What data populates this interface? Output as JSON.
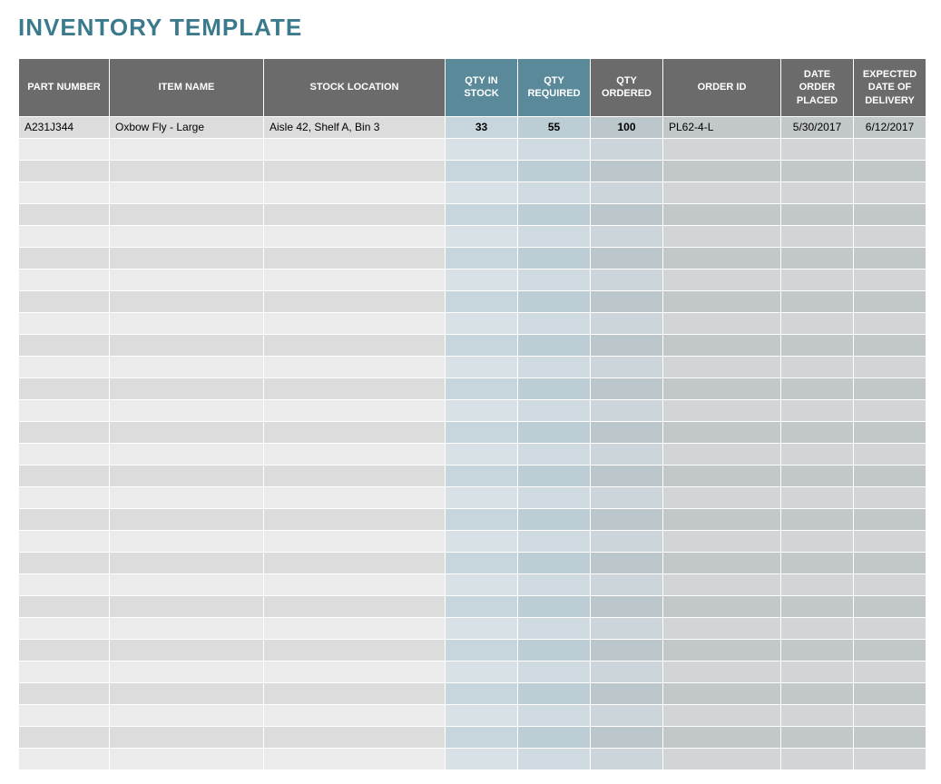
{
  "title": "INVENTORY TEMPLATE",
  "headers": {
    "part_number": "PART NUMBER",
    "item_name": "ITEM NAME",
    "stock_location": "STOCK LOCATION",
    "qty_in_stock": "QTY IN STOCK",
    "qty_required": "QTY REQUIRED",
    "qty_ordered": "QTY ORDERED",
    "order_id": "ORDER ID",
    "date_order_placed": "DATE ORDER PLACED",
    "expected_date_of_delivery": "EXPECTED DATE OF DELIVERY"
  },
  "rows": [
    {
      "part_number": "A231J344",
      "item_name": "Oxbow Fly - Large",
      "stock_location": "Aisle 42, Shelf A, Bin 3",
      "qty_in_stock": "33",
      "qty_required": "55",
      "qty_ordered": "100",
      "order_id": "PL62-4-L",
      "date_order_placed": "5/30/2017",
      "expected_date_of_delivery": "6/12/2017"
    }
  ],
  "empty_row_count": 29
}
